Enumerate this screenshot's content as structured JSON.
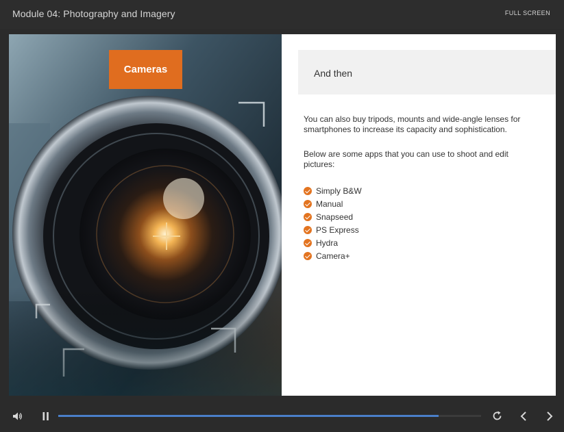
{
  "header": {
    "module_title": "Module 04: Photography and Imagery",
    "fullscreen_label": "FULL SCREEN"
  },
  "slide": {
    "image": {
      "subject": "camera-lens-photo"
    },
    "tag_label": "Cameras",
    "heading": "And then",
    "paragraph_1": "You can also buy tripods, mounts and wide-angle lenses for smartphones to increase its capacity and sophistication.",
    "paragraph_2": "Below are some apps that you can use to shoot and edit pictures:",
    "apps": [
      {
        "label": "Simply B&W"
      },
      {
        "label": "Manual"
      },
      {
        "label": "Snapseed"
      },
      {
        "label": "PS Express"
      },
      {
        "label": "Hydra"
      },
      {
        "label": "Camera+"
      }
    ]
  },
  "player": {
    "progress": 0.9,
    "icons": {
      "volume": "volume-icon",
      "pause": "pause-icon",
      "replay": "replay-icon",
      "prev": "chevron-left-icon",
      "next": "chevron-right-icon"
    }
  },
  "colors": {
    "accent": "#e06d1f",
    "progress": "#4a7fc9",
    "chrome": "#2b2b2b"
  }
}
